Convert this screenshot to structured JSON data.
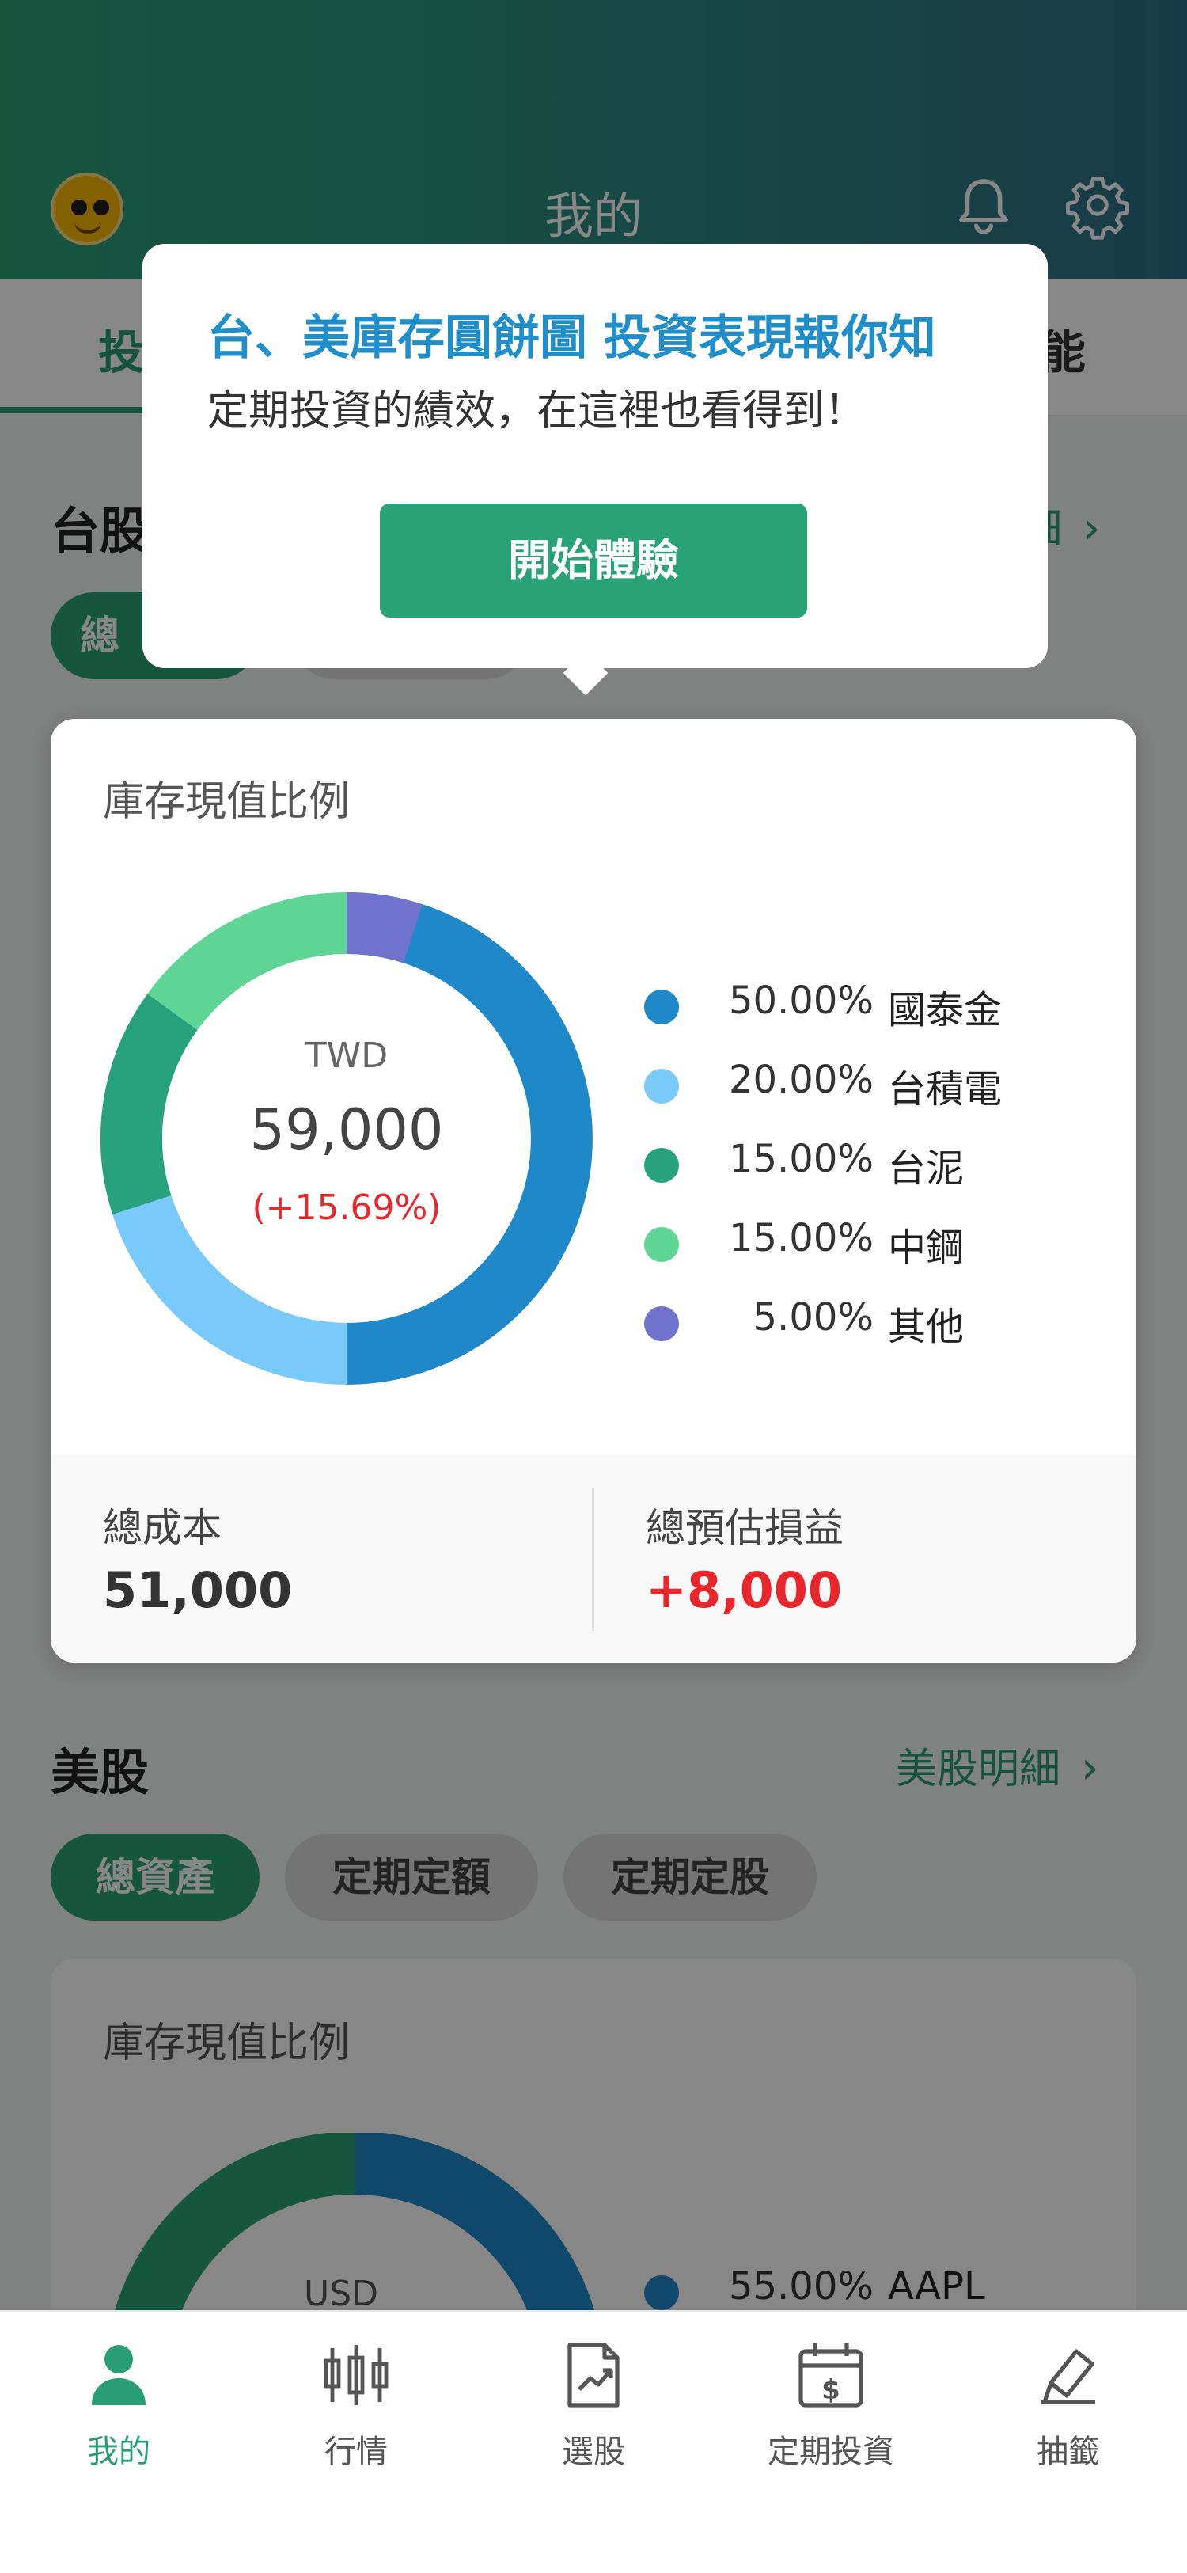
{
  "header": {
    "title": "我的"
  },
  "tabs": [
    {
      "label": "投"
    },
    {
      "label": "能"
    }
  ],
  "tw_section": {
    "title": "台股",
    "detail_link": "細",
    "chips": [
      "總"
    ],
    "card": {
      "label": "庫存現值比例",
      "center_currency": "TWD",
      "center_value": "59,000",
      "center_change": "(+15.69%)",
      "legend": [
        {
          "pct": "50.00%",
          "name": "國泰金",
          "color": "#1e88c9"
        },
        {
          "pct": "20.00%",
          "name": "台積電",
          "color": "#79c9fb"
        },
        {
          "pct": "15.00%",
          "name": "台泥",
          "color": "#27a27c"
        },
        {
          "pct": "15.00%",
          "name": "中鋼",
          "color": "#5ed595"
        },
        {
          "pct": "5.00%",
          "name": "其他",
          "color": "#6f73cb"
        }
      ],
      "total_cost_label": "總成本",
      "total_cost_value": "51,000",
      "total_pl_label": "總預估損益",
      "total_pl_value": "+8,000",
      "positive_color": "#e8262c"
    }
  },
  "us_section": {
    "title": "美股",
    "detail_link": "美股明細",
    "chips": [
      "總資產",
      "定期定額",
      "定期定股"
    ],
    "card": {
      "label": "庫存現值比例",
      "center_currency": "USD",
      "legend": [
        {
          "pct": "55.00%",
          "name": "AAPL",
          "color": "#1e88c9"
        }
      ]
    }
  },
  "popup": {
    "title": "台、美庫存圓餅圖 投資表現報你知",
    "subtitle": "定期投資的績效，在這裡也看得到！",
    "button": "開始體驗"
  },
  "bottom_nav": [
    {
      "label": "我的",
      "icon": "person-icon"
    },
    {
      "label": "行情",
      "icon": "candlestick-icon"
    },
    {
      "label": "選股",
      "icon": "stock-doc-icon"
    },
    {
      "label": "定期投資",
      "icon": "calendar-dollar-icon"
    },
    {
      "label": "抽籤",
      "icon": "lottery-icon"
    }
  ]
}
